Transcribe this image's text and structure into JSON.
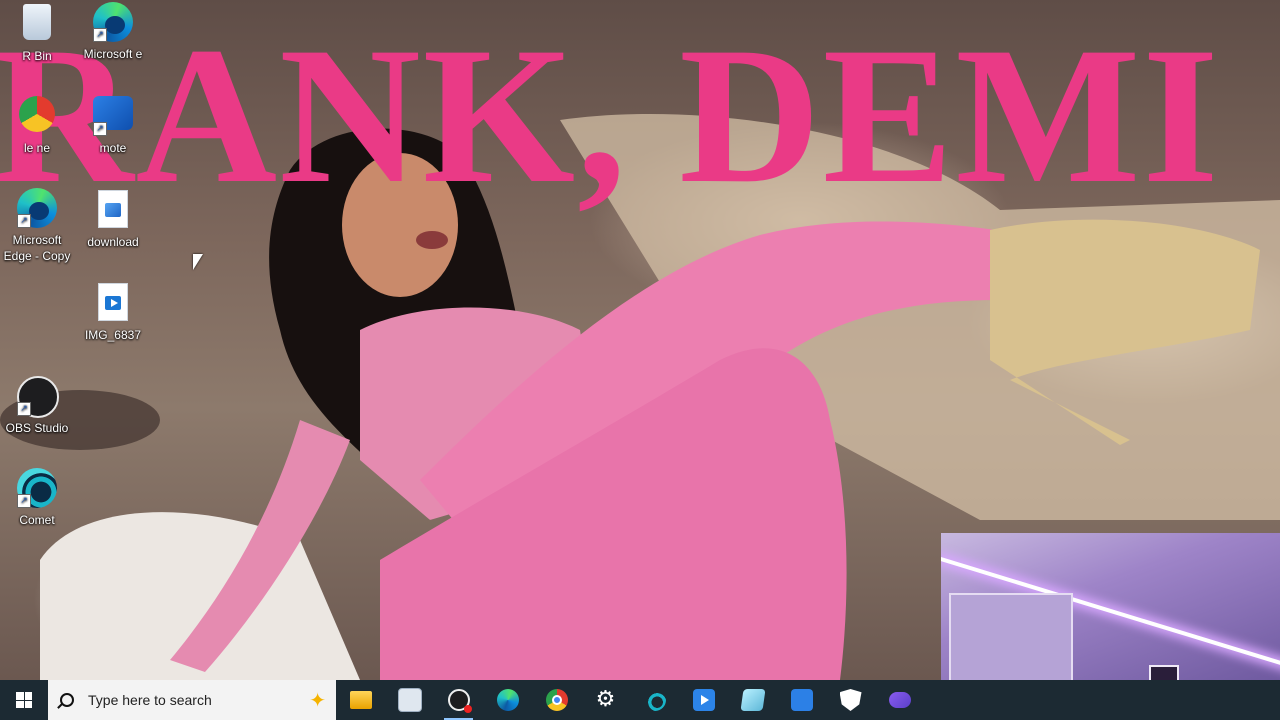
{
  "wallpaper": {
    "headline": "RANK, DEMI",
    "headline_color": "#ea3a86"
  },
  "desktop_icons": [
    {
      "label": "Recycle Bin",
      "visible_label": "R   Bin",
      "icon": "recycle-bin-icon"
    },
    {
      "label": "Microsoft Edge",
      "visible_label": "Microsoft e",
      "icon": "edge-icon"
    },
    {
      "label": "Google Chrome",
      "visible_label": "le ne",
      "icon": "chrome-icon"
    },
    {
      "label": "Remote",
      "visible_label": "mote",
      "icon": "remote-play-icon"
    },
    {
      "label": "Microsoft Edge - Copy",
      "visible_label": "Microsoft Edge - Copy",
      "icon": "edge-icon"
    },
    {
      "label": "download",
      "visible_label": "download",
      "icon": "image-file-icon"
    },
    {
      "label": "IMG_6837",
      "visible_label": "IMG_6837",
      "icon": "video-file-icon"
    },
    {
      "label": "OBS Studio",
      "visible_label": "OBS Studio",
      "icon": "obs-icon"
    },
    {
      "label": "Comet",
      "visible_label": "Comet",
      "icon": "comet-icon"
    }
  ],
  "taskbar": {
    "search_placeholder": "Type here to search",
    "apps": [
      {
        "name": "File Explorer",
        "icon": "folder-icon"
      },
      {
        "name": "Files",
        "icon": "files-icon"
      },
      {
        "name": "OBS Studio",
        "icon": "obs-recording-icon",
        "active": true
      },
      {
        "name": "Microsoft Edge",
        "icon": "edge-icon"
      },
      {
        "name": "Google Chrome",
        "icon": "chrome-icon"
      },
      {
        "name": "Settings",
        "icon": "gear-icon"
      },
      {
        "name": "Comet",
        "icon": "comet-icon"
      },
      {
        "name": "Media Player",
        "icon": "media-player-icon"
      },
      {
        "name": "Notes",
        "icon": "notes-icon"
      },
      {
        "name": "Remote Play",
        "icon": "remote-play-icon"
      },
      {
        "name": "Windows Security",
        "icon": "shield-icon"
      },
      {
        "name": "Game Controller",
        "icon": "gamepad-icon"
      }
    ]
  }
}
